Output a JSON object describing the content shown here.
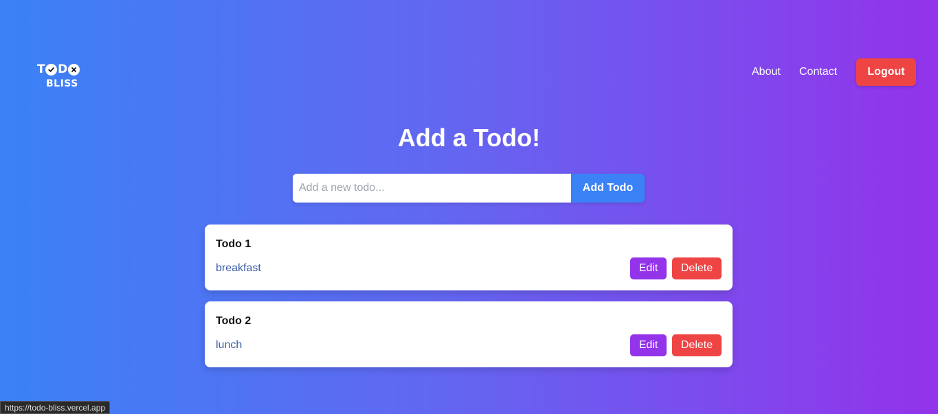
{
  "logo": {
    "top_letters": [
      "T",
      "D"
    ],
    "check_icon": "check-circle-icon",
    "x_icon": "x-circle-icon",
    "bottom_text": "BLISS"
  },
  "nav": {
    "about": "About",
    "contact": "Contact",
    "logout": "Logout"
  },
  "main": {
    "heading": "Add a Todo!",
    "input_placeholder": "Add a new todo...",
    "input_value": "",
    "add_button": "Add Todo"
  },
  "todos": [
    {
      "title": "Todo 1",
      "text": "breakfast",
      "edit": "Edit",
      "delete": "Delete"
    },
    {
      "title": "Todo 2",
      "text": "lunch",
      "edit": "Edit",
      "delete": "Delete"
    }
  ],
  "status_bar": {
    "url": "https://todo-bliss.vercel.app"
  },
  "colors": {
    "gradient_start": "#3b82f6",
    "gradient_mid": "#6366f1",
    "gradient_end": "#9333ea",
    "logout": "#ef4444",
    "add_button": "#3b82f6",
    "edit": "#9333ea",
    "delete": "#ef4444"
  }
}
